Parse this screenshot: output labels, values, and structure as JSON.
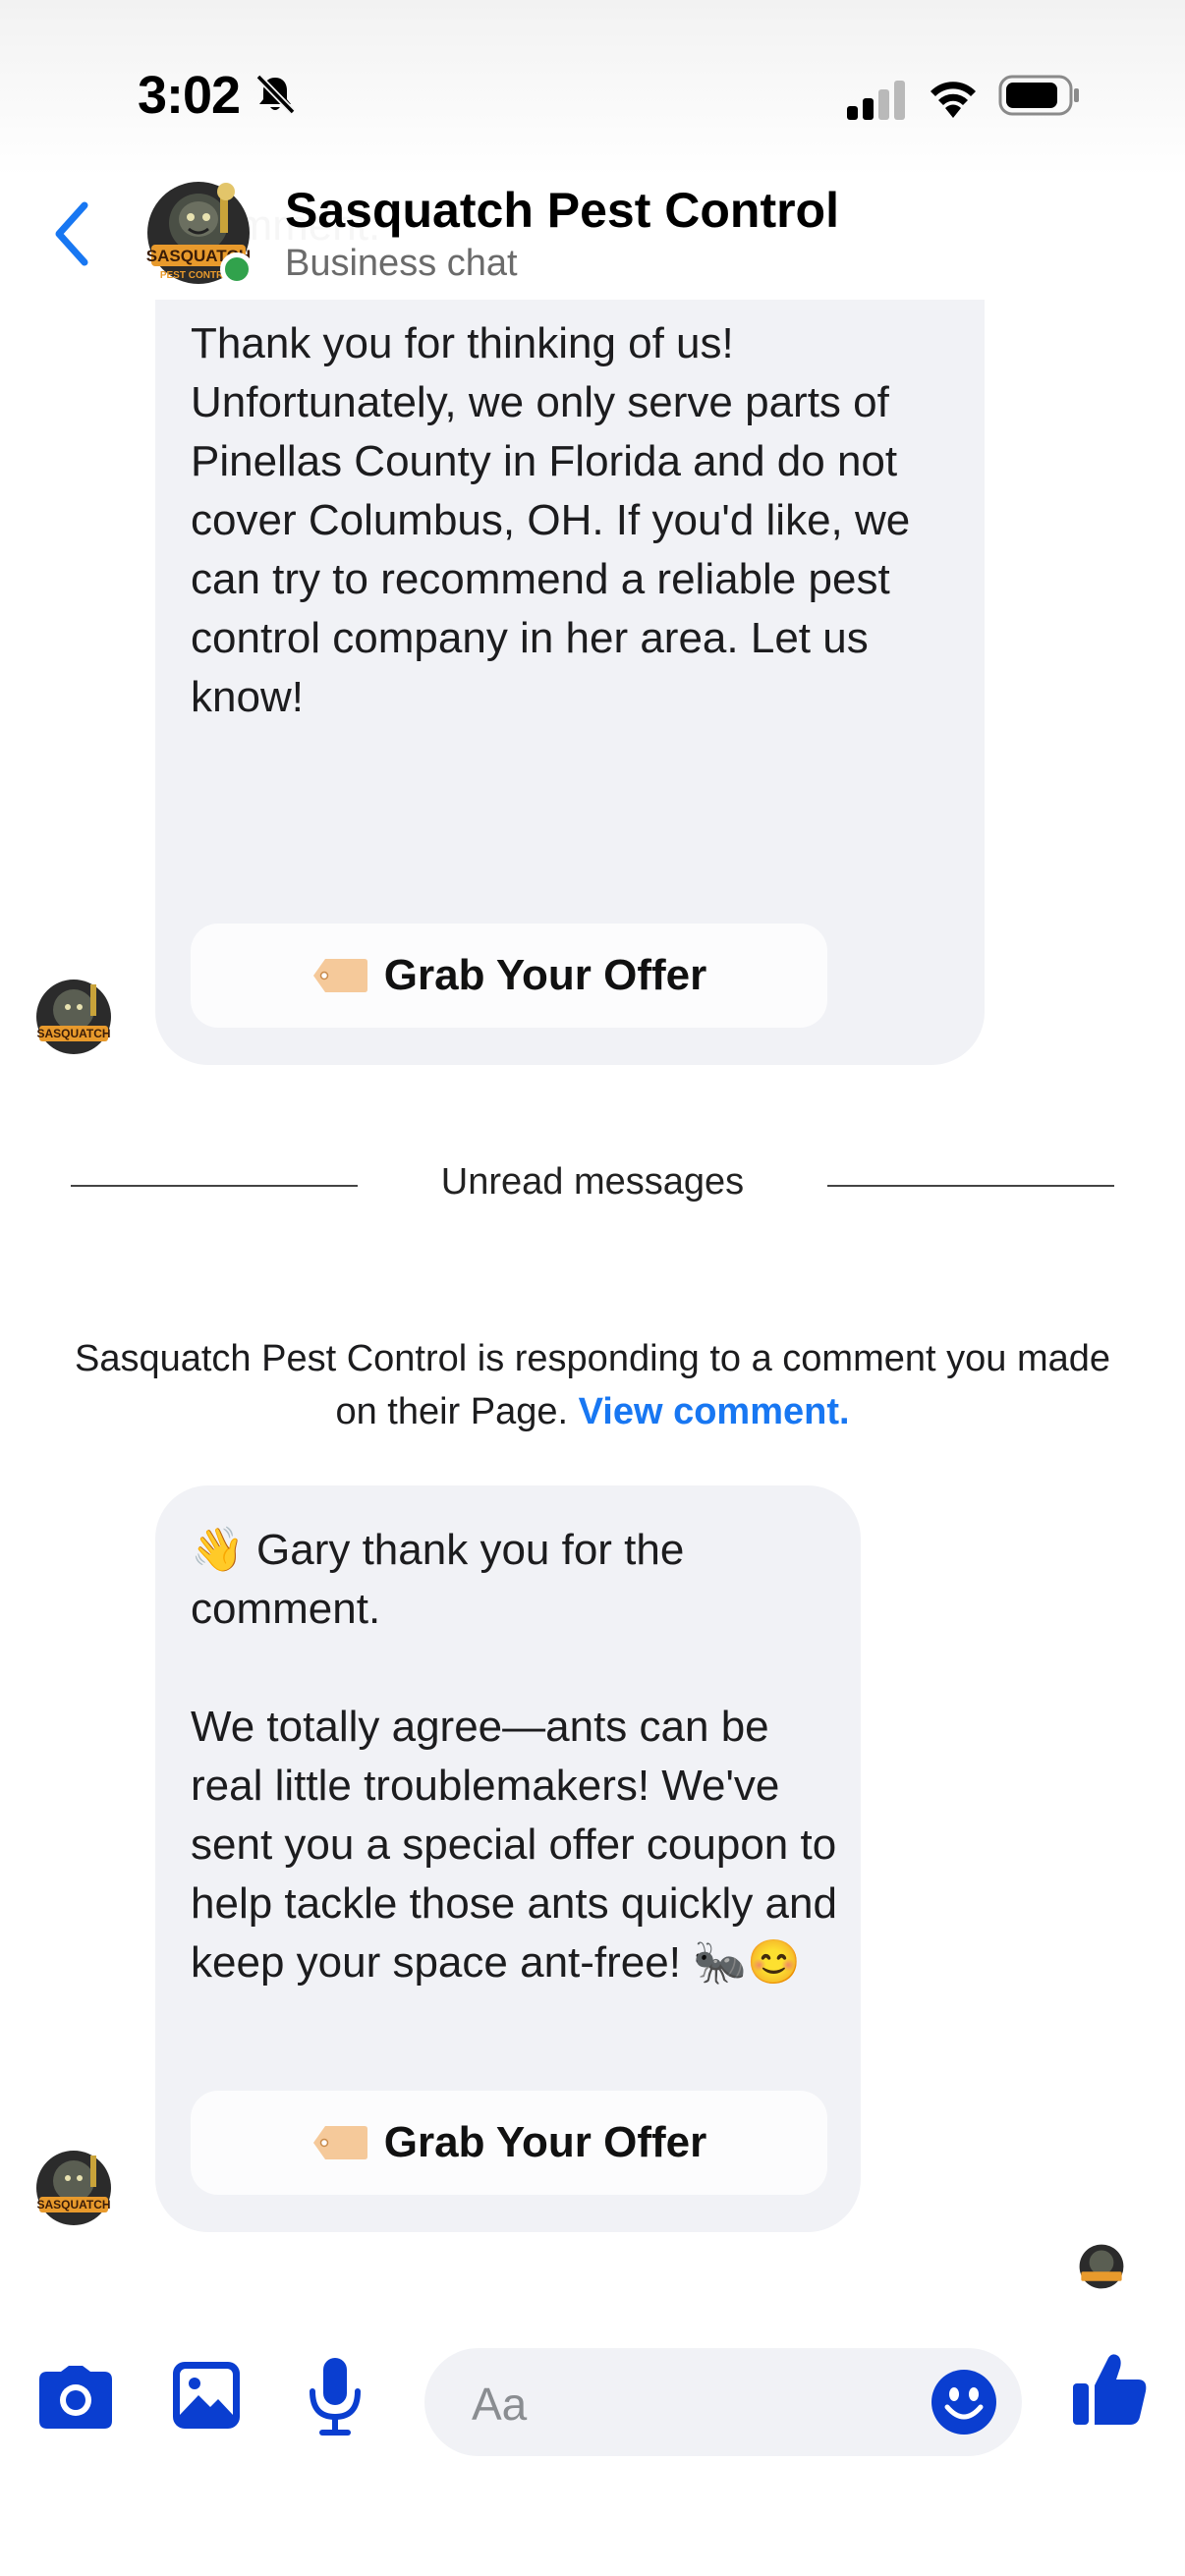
{
  "status_bar": {
    "time": "3:02",
    "icons": [
      "bell-slash-icon",
      "cellular-signal-icon",
      "wifi-icon",
      "battery-icon"
    ]
  },
  "header": {
    "title": "Sasquatch Pest Control",
    "subtitle": "Business chat",
    "online": true
  },
  "messages": [
    {
      "text": "comment.\n\nThank you for thinking of us! Unfortunately, we only serve parts of Pinellas County in Florida and do not cover Columbus, OH. If you'd like, we can try to recommend a reliable pest control company in her area. Let us know!",
      "button": "Grab Your Offer"
    },
    {
      "text": "👋 Gary thank you for the comment.\n\nWe totally agree—ants can be real little troublemakers! We've sent you a special offer coupon to help tackle those ants quickly and keep your space ant-free! 🐜😊",
      "button": "Grab Your Offer"
    }
  ],
  "divider": {
    "label": "Unread messages"
  },
  "context_note": {
    "text": "Sasquatch Pest Control is responding to a comment you made on their Page.",
    "link": "View comment."
  },
  "composer": {
    "placeholder": "Aa"
  },
  "colors": {
    "accent": "#1877f2",
    "composer_icons": "#0a3ed0",
    "bubble": "#f1f2f6",
    "online": "#31a24c"
  }
}
